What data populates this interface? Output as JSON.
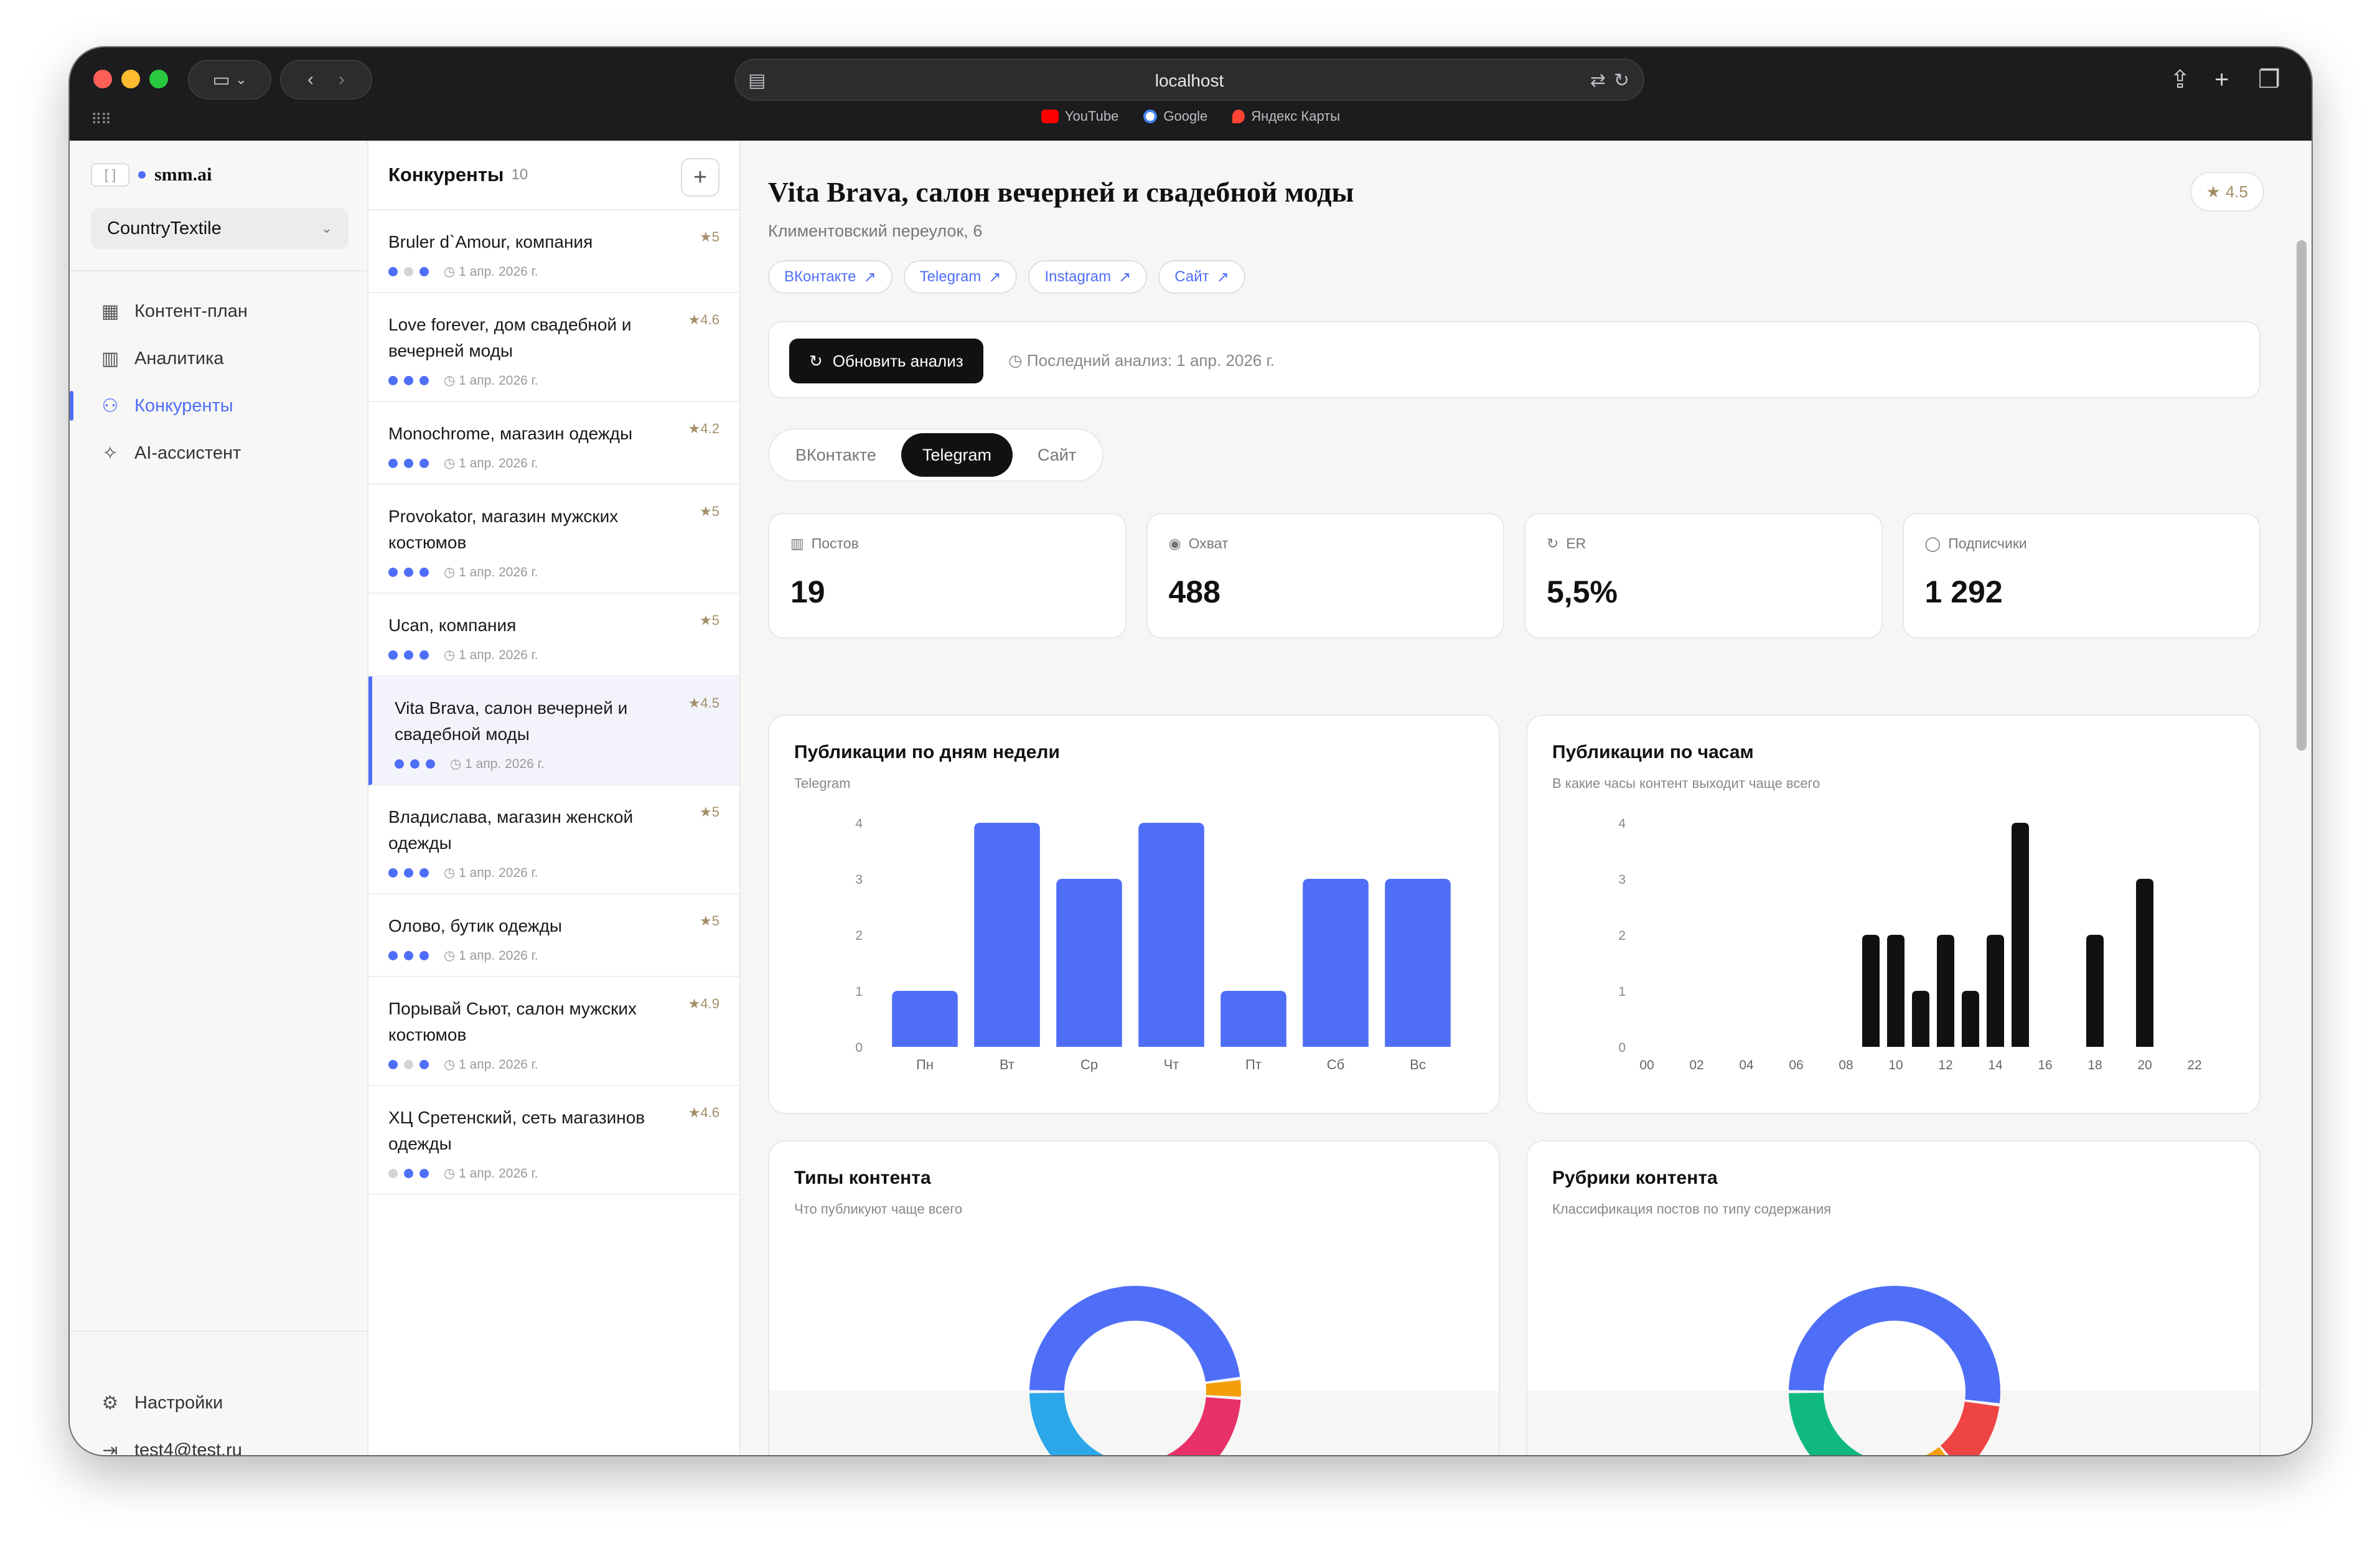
{
  "browser": {
    "url": "localhost",
    "bookmarks": [
      {
        "label": "YouTube",
        "color": "#ff0000"
      },
      {
        "label": "Google",
        "color": "#4285f4"
      },
      {
        "label": "Яндекс Карты",
        "color": "#ff4433"
      }
    ]
  },
  "sidebar": {
    "brand_name": "smm.ai",
    "brand_bracket": "[ ]",
    "workspace": "CountryTextile",
    "nav": [
      {
        "label": "Контент-план",
        "icon": "calendar-icon"
      },
      {
        "label": "Аналитика",
        "icon": "bar-chart-icon"
      },
      {
        "label": "Конкуренты",
        "icon": "users-icon",
        "active": true
      },
      {
        "label": "AI-ассистент",
        "icon": "sparkle-icon"
      }
    ],
    "settings_label": "Настройки",
    "user_email": "test4@test.ru"
  },
  "competitors": {
    "title": "Конкуренты",
    "count": "10",
    "add_label": "+",
    "items": [
      {
        "name": "Bruler d`Amour, компания",
        "rating": "5",
        "date": "1 апр. 2026 г.",
        "dots": [
          1,
          0,
          1
        ]
      },
      {
        "name": "Love forever, дом свадебной и вечерней моды",
        "rating": "4.6",
        "date": "1 апр. 2026 г.",
        "dots": [
          1,
          1,
          1
        ]
      },
      {
        "name": "Monochrome, магазин одежды",
        "rating": "4.2",
        "date": "1 апр. 2026 г.",
        "dots": [
          1,
          1,
          1
        ]
      },
      {
        "name": "Provokator, магазин мужских костюмов",
        "rating": "5",
        "date": "1 апр. 2026 г.",
        "dots": [
          1,
          1,
          1
        ]
      },
      {
        "name": "Ucan, компания",
        "rating": "5",
        "date": "1 апр. 2026 г.",
        "dots": [
          1,
          1,
          1
        ]
      },
      {
        "name": "Vita Brava, салон вечерней и свадебной моды",
        "rating": "4.5",
        "date": "1 апр. 2026 г.",
        "dots": [
          1,
          1,
          1
        ],
        "active": true
      },
      {
        "name": "Владислава, магазин женской одежды",
        "rating": "5",
        "date": "1 апр. 2026 г.",
        "dots": [
          1,
          1,
          1
        ]
      },
      {
        "name": "Олово, бутик одежды",
        "rating": "5",
        "date": "1 апр. 2026 г.",
        "dots": [
          1,
          1,
          1
        ]
      },
      {
        "name": "Порывай Сьют, салон мужских костюмов",
        "rating": "4.9",
        "date": "1 апр. 2026 г.",
        "dots": [
          1,
          0,
          1
        ]
      },
      {
        "name": "ХЦ Сретенский, сеть магазинов одежды",
        "rating": "4.6",
        "date": "1 апр. 2026 г.",
        "dots": [
          0,
          1,
          1
        ]
      }
    ]
  },
  "detail": {
    "title": "Vita Brava, салон вечерней и свадебной моды",
    "address": "Климентовский переулок, 6",
    "rating": "4.5",
    "links": [
      "ВКонтакте",
      "Telegram",
      "Instagram",
      "Сайт"
    ],
    "refresh_label": "Обновить анализ",
    "last_analysis": "Последний анализ: 1 апр. 2026 г.",
    "tabs": [
      {
        "label": "ВКонтакте"
      },
      {
        "label": "Telegram",
        "active": true
      },
      {
        "label": "Сайт"
      }
    ],
    "stats": [
      {
        "label": "Постов",
        "value": "19",
        "icon": "bar-chart-icon"
      },
      {
        "label": "Охват",
        "value": "488",
        "icon": "eye-icon"
      },
      {
        "label": "ER",
        "value": "5,5%",
        "icon": "refresh-icon"
      },
      {
        "label": "Подписчики",
        "value": "1 292",
        "icon": "chat-bubble-icon"
      }
    ],
    "cards": {
      "weekday_title": "Публикации по дням недели",
      "weekday_sub": "Telegram",
      "hours_title": "Публикации по часам",
      "hours_sub": "В какие часы контент выходит чаще всего",
      "types_title": "Типы контента",
      "types_sub": "Что публикуют чаще всего",
      "rubrics_title": "Рубрики контента",
      "rubrics_sub": "Классификация постов по типу содержания"
    }
  },
  "colors": {
    "accent": "#4f6ef7",
    "bar_blue": "#4f6ef7",
    "bar_black": "#111111"
  },
  "chart_data": [
    {
      "type": "bar",
      "title": "Публикации по дням недели",
      "categories": [
        "Пн",
        "Вт",
        "Ср",
        "Чт",
        "Пт",
        "Сб",
        "Вс"
      ],
      "values": [
        1,
        4,
        3,
        4,
        1,
        3,
        3
      ],
      "yticks": [
        0,
        1,
        2,
        3,
        4
      ],
      "ylim": [
        0,
        4
      ],
      "color": "#4f6ef7"
    },
    {
      "type": "bar",
      "title": "Публикации по часам",
      "x": [
        9,
        10,
        11,
        12,
        13,
        14,
        15,
        18,
        20
      ],
      "values": [
        2,
        2,
        1,
        2,
        1,
        2,
        4,
        2,
        3
      ],
      "xticks": [
        "00",
        "02",
        "04",
        "06",
        "08",
        "10",
        "12",
        "14",
        "16",
        "18",
        "20",
        "22"
      ],
      "yticks": [
        0,
        1,
        2,
        3,
        4
      ],
      "ylim": [
        0,
        4
      ],
      "xlim": [
        0,
        23
      ],
      "color": "#111111"
    },
    {
      "type": "pie",
      "title": "Типы контента",
      "values": [
        48,
        3,
        22,
        27
      ],
      "colors": [
        "#4f6ef7",
        "#f59e0b",
        "#e8306a",
        "#2ba7ea"
      ]
    },
    {
      "type": "pie",
      "title": "Рубрики контента",
      "values": [
        52,
        12,
        18,
        18
      ],
      "colors": [
        "#4f6ef7",
        "#ef4444",
        "#f59e0b",
        "#10b981"
      ]
    }
  ]
}
